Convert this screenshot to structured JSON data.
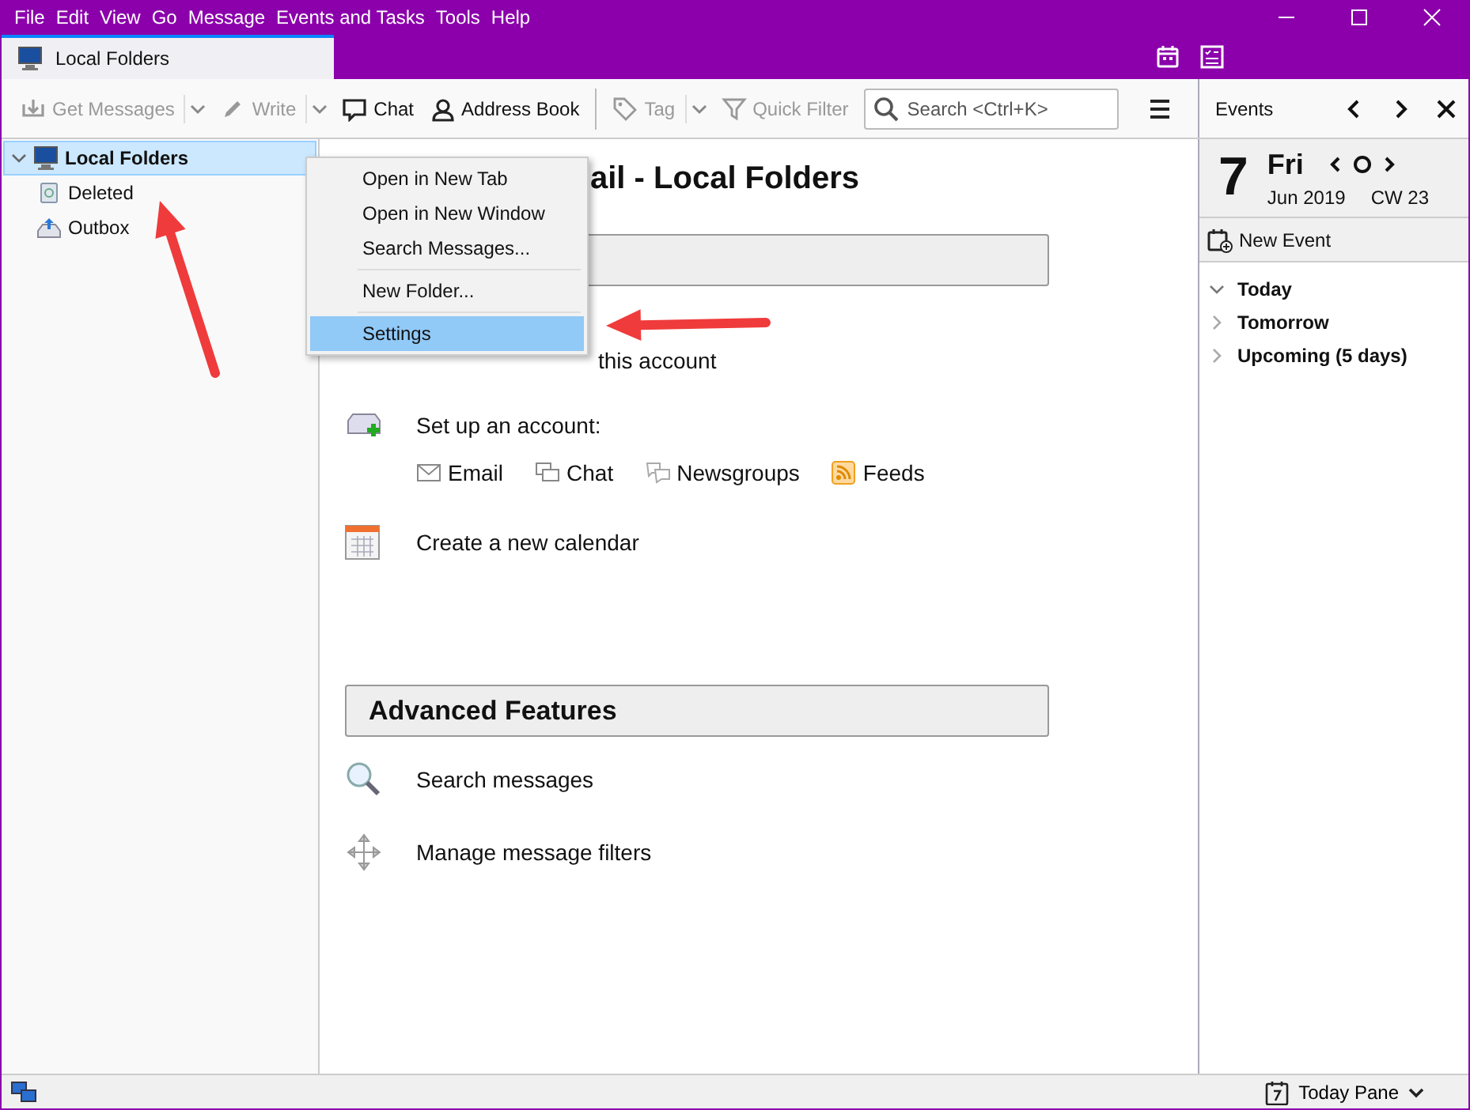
{
  "window": {
    "title_bar_items": [
      "File",
      "Edit",
      "View",
      "Go",
      "Message",
      "Events and Tasks",
      "Tools",
      "Help"
    ]
  },
  "tabs": [
    {
      "label": "Local Folders",
      "selected": true
    }
  ],
  "toolbar": [
    {
      "label": "Get Messages",
      "kind": "button",
      "disabled": true,
      "dropdown": true
    },
    {
      "label": "Write",
      "kind": "button",
      "disabled": true,
      "dropdown": true
    },
    {
      "label": "Chat",
      "kind": "button",
      "disabled": false,
      "dropdown": false
    },
    {
      "label": "Address Book",
      "kind": "button",
      "disabled": false,
      "dropdown": false
    },
    {
      "label": "Tag",
      "kind": "button",
      "disabled": true,
      "dropdown": true
    },
    {
      "label": "Quick Filter",
      "kind": "button",
      "disabled": true,
      "dropdown": false
    }
  ],
  "search": {
    "placeholder": "Search <Ctrl+K>"
  },
  "folders": [
    {
      "label": "Local Folders",
      "selected": true,
      "expanded": true,
      "children": [
        {
          "label": "Deleted",
          "selected": false
        },
        {
          "label": "Outbox",
          "selected": false
        }
      ]
    }
  ],
  "context_menu": [
    [
      {
        "label": "Open in New Tab",
        "selected": false
      },
      {
        "label": "Open in New Window",
        "selected": false
      },
      {
        "label": "Search Messages...",
        "selected": false
      }
    ],
    [
      {
        "label": "New Folder...",
        "selected": false
      }
    ],
    [
      {
        "label": "Settings",
        "selected": true
      }
    ]
  ],
  "content": {
    "title": "ail - Local Folders",
    "settings_text": "this account",
    "setup_label": "Set up an account:",
    "setup_links": [
      {
        "label": "Email",
        "kind": "email"
      },
      {
        "label": "Chat",
        "kind": "chat"
      },
      {
        "label": "Newsgroups",
        "kind": "news"
      },
      {
        "label": "Feeds",
        "kind": "feed"
      }
    ],
    "calendar_text": "Create a new calendar",
    "advanced_header": "Advanced Features",
    "advanced_items": [
      {
        "label": "Search messages",
        "kind": "search"
      },
      {
        "label": "Manage message filters",
        "kind": "filter"
      }
    ]
  },
  "today_pane": {
    "header": "Events",
    "day": "7",
    "weekday": "Fri",
    "month": "Jun 2019",
    "week": "CW 23",
    "new_event": "New Event",
    "sections": [
      {
        "label": "Today",
        "expanded": true
      },
      {
        "label": "Tomorrow",
        "expanded": false
      },
      {
        "label": "Upcoming (5 days)",
        "expanded": false
      }
    ]
  },
  "status_bar": {
    "today_pane": "Today Pane"
  }
}
